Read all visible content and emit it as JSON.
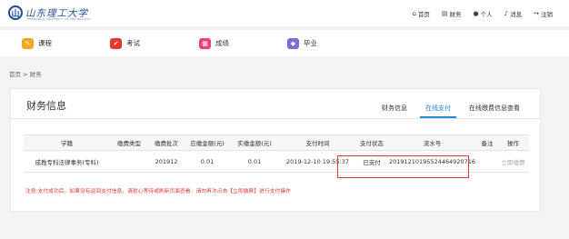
{
  "logo": {
    "text": "山东理工大学",
    "sub": "SHANDONG UNIVERSITY OF TECHNOLOGY"
  },
  "toplinks": [
    {
      "label": "首页",
      "icon": "home-icon",
      "glyph": "⌂"
    },
    {
      "label": "财务",
      "icon": "finance-icon",
      "glyph": "▤"
    },
    {
      "label": "个人",
      "icon": "user-icon",
      "glyph": "●"
    },
    {
      "label": "消息",
      "icon": "bell-icon",
      "glyph": "♪"
    },
    {
      "label": "注销",
      "icon": "logout-icon",
      "glyph": "↪"
    }
  ],
  "nav": [
    {
      "label": "课程",
      "color": "#f5a623",
      "glyph": "✎"
    },
    {
      "label": "考试",
      "color": "#e53935",
      "glyph": "✔"
    },
    {
      "label": "成绩",
      "color": "#ec407a",
      "glyph": "▦"
    },
    {
      "label": "毕业",
      "color": "#7e6bd9",
      "glyph": "◆"
    }
  ],
  "breadcrumb": "首页 > 财务",
  "card": {
    "title": "财务信息",
    "tabs": [
      "财务信息",
      "在线支付",
      "在线缴费信息查看"
    ],
    "active_tab": 1
  },
  "table": {
    "headers": [
      "学籍",
      "缴费类型",
      "缴费批次",
      "应缴金额(元)",
      "实缴金额(元)",
      "支付时间",
      "支付状态",
      "流水号",
      "备注",
      "操作"
    ],
    "rows": [
      [
        "成教专科法律事务(专科)",
        "",
        "201912",
        "0.01",
        "0.01",
        "2019-12-10 19:55:37",
        "已支付",
        "2019121019552446492071​6",
        "",
        "立即缴费"
      ]
    ]
  },
  "note": "注意:支付成功后，如果没有返回支付信息，请耐心等待或刷新页面查看，请勿再次点击【立即缴费】进行支付操作",
  "colors": {
    "accent": "#1e88e5",
    "warning": "#e53935"
  }
}
